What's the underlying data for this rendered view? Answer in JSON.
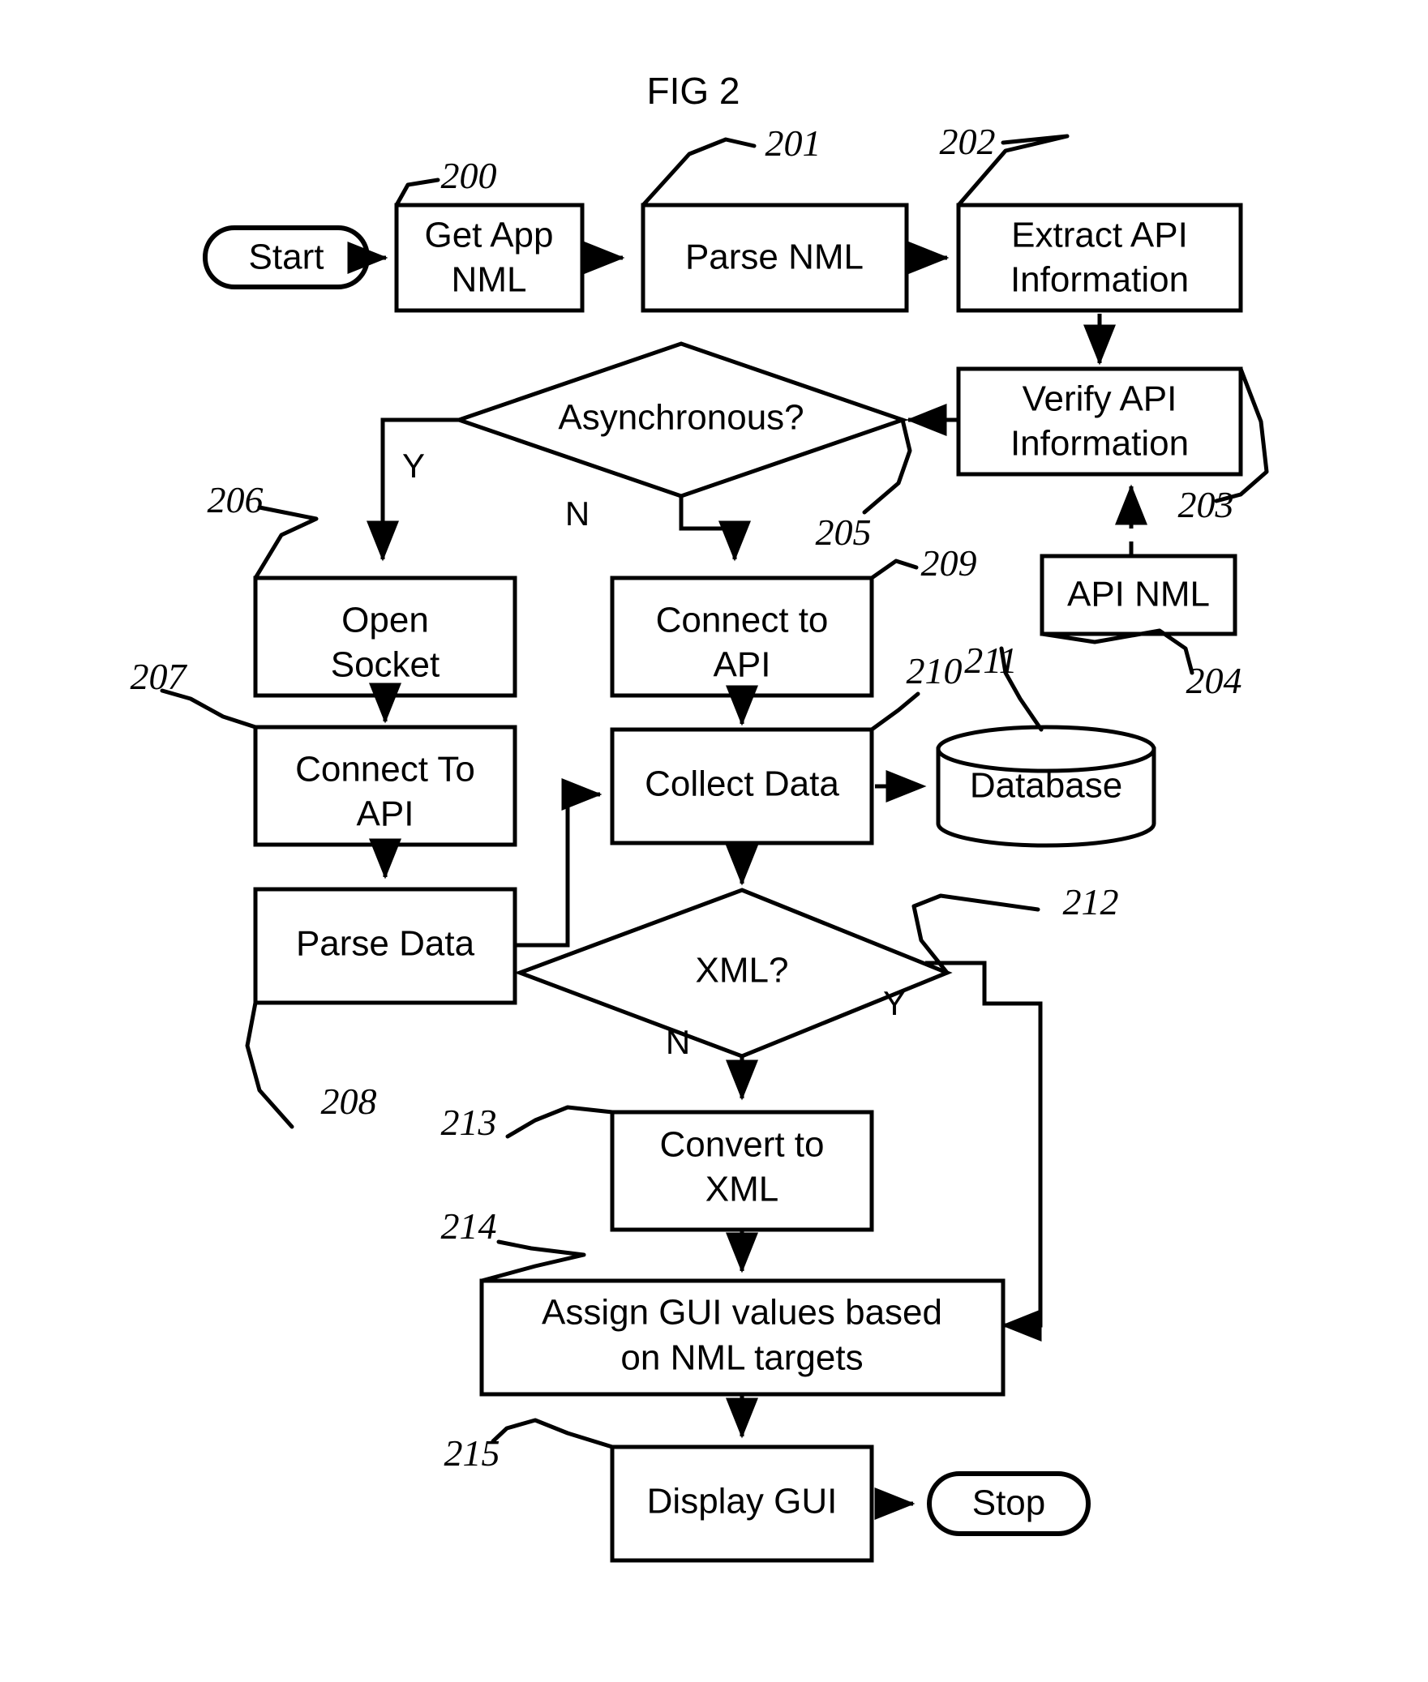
{
  "figure": {
    "title": "FIG 2",
    "type": "flowchart"
  },
  "nodes": {
    "start": {
      "label": "Start",
      "shape": "terminator",
      "ref": ""
    },
    "get_app_nml": {
      "label_line1": "Get App",
      "label_line2": "NML",
      "shape": "process",
      "ref": "200"
    },
    "parse_nml": {
      "label": "Parse NML",
      "shape": "process",
      "ref": "201"
    },
    "extract_api_info": {
      "label_line1": "Extract API",
      "label_line2": "Information",
      "shape": "process",
      "ref": "202"
    },
    "verify_api_info": {
      "label_line1": "Verify API",
      "label_line2": "Information",
      "shape": "process",
      "ref": "203"
    },
    "api_nml": {
      "label": "API NML",
      "shape": "process",
      "ref": "204"
    },
    "asynchronous": {
      "label": "Asynchronous?",
      "shape": "decision",
      "ref": "205"
    },
    "open_socket": {
      "label_line1": "Open",
      "label_line2": "Socket",
      "shape": "process",
      "ref": "206"
    },
    "connect_to_api_left": {
      "label_line1": "Connect To",
      "label_line2": "API",
      "shape": "process",
      "ref": "207"
    },
    "parse_data": {
      "label": "Parse Data",
      "shape": "process",
      "ref": "208"
    },
    "connect_to_api_mid": {
      "label_line1": "Connect to",
      "label_line2": "API",
      "shape": "process",
      "ref": "209"
    },
    "collect_data": {
      "label": "Collect Data",
      "shape": "process",
      "ref": "210"
    },
    "database": {
      "label": "Database",
      "shape": "cylinder",
      "ref": "211"
    },
    "xml_decision": {
      "label": "XML?",
      "shape": "decision",
      "ref": "212"
    },
    "convert_to_xml": {
      "label_line1": "Convert to",
      "label_line2": "XML",
      "shape": "process",
      "ref": "213"
    },
    "assign_gui": {
      "label_line1": "Assign GUI values based",
      "label_line2": "on NML targets",
      "shape": "process",
      "ref": "214"
    },
    "display_gui": {
      "label": "Display GUI",
      "shape": "process",
      "ref": "215"
    },
    "stop": {
      "label": "Stop",
      "shape": "terminator",
      "ref": ""
    }
  },
  "branch_labels": {
    "async_yes": "Y",
    "async_no": "N",
    "xml_yes": "Y",
    "xml_no": "N"
  },
  "reference_numerals": {
    "n200": "200",
    "n201": "201",
    "n202": "202",
    "n203": "203",
    "n204": "204",
    "n205": "205",
    "n206": "206",
    "n207": "207",
    "n208": "208",
    "n209": "209",
    "n210": "210",
    "n211": "211",
    "n212": "212",
    "n213": "213",
    "n214": "214",
    "n215": "215"
  },
  "colors": {
    "stroke": "#000000",
    "fill": "#ffffff",
    "background": "#ffffff"
  }
}
